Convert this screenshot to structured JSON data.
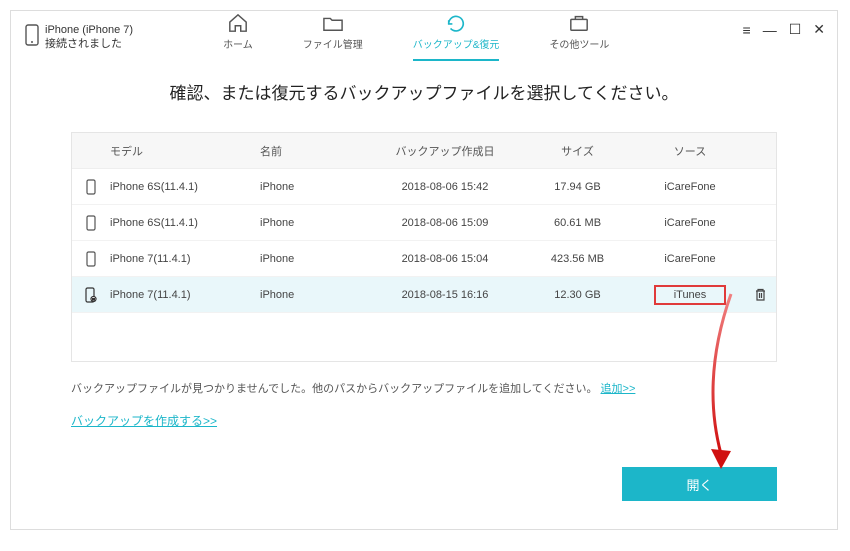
{
  "device": {
    "name": "iPhone (iPhone 7)",
    "status": "接続されました"
  },
  "nav": {
    "home": "ホーム",
    "files": "ファイル管理",
    "backup": "バックアップ&復元",
    "tools": "その他ツール"
  },
  "prompt": "確認、または復元するバックアップファイルを選択してください。",
  "headers": {
    "model": "モデル",
    "name": "名前",
    "date": "バックアップ作成日",
    "size": "サイズ",
    "source": "ソース"
  },
  "rows": [
    {
      "model": "iPhone 6S(11.4.1)",
      "name": "iPhone",
      "date": "2018-08-06 15:42",
      "size": "17.94 GB",
      "source": "iCareFone"
    },
    {
      "model": "iPhone 6S(11.4.1)",
      "name": "iPhone",
      "date": "2018-08-06 15:09",
      "size": "60.61 MB",
      "source": "iCareFone"
    },
    {
      "model": "iPhone 7(11.4.1)",
      "name": "iPhone",
      "date": "2018-08-06 15:04",
      "size": "423.56 MB",
      "source": "iCareFone"
    },
    {
      "model": "iPhone 7(11.4.1)",
      "name": "iPhone",
      "date": "2018-08-15 16:16",
      "size": "12.30 GB",
      "source": "iTunes"
    }
  ],
  "footer": {
    "notfound_text": "バックアップファイルが見つかりませんでした。他のパスからバックアップファイルを追加してください。",
    "add_link": "追加>>",
    "create_link": "バックアップを作成する>>"
  },
  "open_button": "開く"
}
